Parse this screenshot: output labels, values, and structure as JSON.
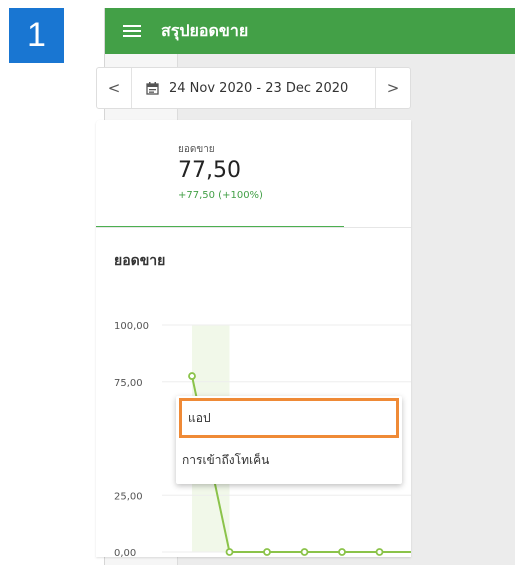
{
  "step": {
    "number": "1",
    "color": "#1976d2"
  },
  "header": {
    "title": "สรุปยอดขาย",
    "background": "#43a047"
  },
  "sidebar": {
    "items": [
      {
        "icon": "account-circle-icon",
        "active": false
      },
      {
        "icon": "bar-chart-icon",
        "active": true
      },
      {
        "icon": "shopping-basket-icon",
        "active": false
      },
      {
        "icon": "hand-truck-icon",
        "active": false
      },
      {
        "icon": "id-card-icon",
        "active": false
      },
      {
        "icon": "people-icon",
        "active": false
      },
      {
        "icon": "puzzle-icon",
        "active": false
      },
      {
        "icon": "gear-icon",
        "active": false
      },
      {
        "icon": "help-icon",
        "active": false
      }
    ]
  },
  "date_picker": {
    "prev": "<",
    "range": "24 Nov 2020 - 23 Dec 2020",
    "next": ">"
  },
  "kpi": {
    "label": "ยอดขาย",
    "value": "77,50",
    "change": "+77,50 (+100%)"
  },
  "chart": {
    "title": "ยอดขาย"
  },
  "chart_data": {
    "type": "line",
    "title": "ยอดขาย",
    "yticks": [
      "100,00",
      "75,00",
      "25,00",
      "0,00"
    ],
    "ylim": [
      0,
      100
    ],
    "series": [
      {
        "values": [
          77.5,
          0,
          0,
          0,
          0,
          0,
          0,
          0,
          0,
          0
        ]
      }
    ],
    "grid": true,
    "colors": {
      "line": "#8bc34a"
    }
  },
  "popup_menu": {
    "items": [
      {
        "label": "แอป",
        "highlighted": true
      },
      {
        "label": "การเข้าถึงโทเค็น",
        "highlighted": false
      }
    ],
    "highlight_color": "#ef8a36"
  }
}
